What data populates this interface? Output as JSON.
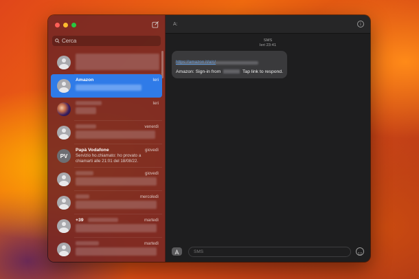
{
  "sidebar": {
    "search_placeholder": "Cerca",
    "items": [
      {
        "name": "",
        "date": "",
        "preview": ""
      },
      {
        "name": "Amazon",
        "date": "Ieri",
        "preview": ""
      },
      {
        "name": "",
        "date": "Ieri",
        "preview": ""
      },
      {
        "name": "",
        "date": "venerdì",
        "preview": ""
      },
      {
        "name": "Papà Vodafone",
        "date": "giovedì",
        "preview": "Servizio ho.chiamato: ho provato a chiamarti alle 21:01 del 18/08/22.",
        "initials": "PV"
      },
      {
        "name": "",
        "date": "giovedì",
        "preview": ""
      },
      {
        "name": "",
        "date": "mercoledì",
        "preview": ""
      },
      {
        "name": "+39",
        "date": "martedì",
        "preview": ""
      },
      {
        "name": "",
        "date": "martedì",
        "preview": ""
      }
    ]
  },
  "conversation": {
    "to_label": "A:",
    "service": "SMS",
    "timestamp": "Ieri 23:41",
    "link_text": "https://amazon.it/a/c/",
    "message_start": "Amazon: Sign-in from",
    "message_end": "Tap link to respond.",
    "input_placeholder": "SMS"
  },
  "colors": {
    "selection": "#2f7be8",
    "link": "#4ea1ff",
    "close": "#ff5f57",
    "minimize": "#febc2e",
    "zoom": "#28c840"
  }
}
